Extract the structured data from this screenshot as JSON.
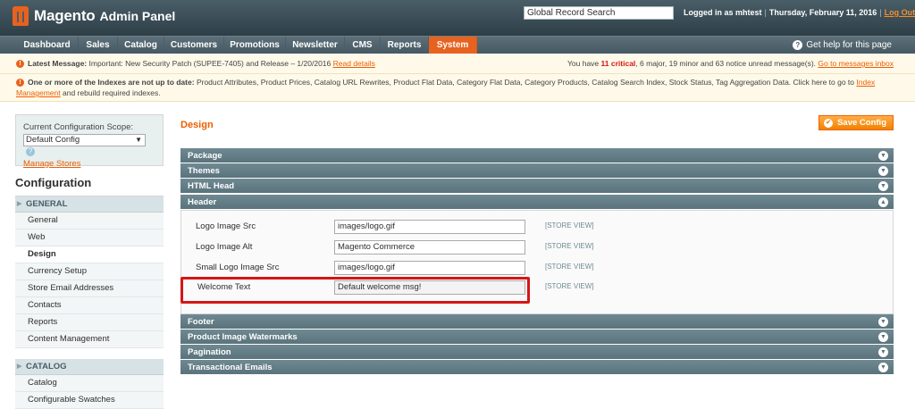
{
  "header": {
    "logo_text": "Magento",
    "logo_sub": "Admin Panel",
    "search_value": "Global Record Search",
    "logged_in": "Logged in as mhtest",
    "date": "Thursday, February 11, 2016",
    "logout": "Log Out"
  },
  "nav": {
    "items": [
      "Dashboard",
      "Sales",
      "Catalog",
      "Customers",
      "Promotions",
      "Newsletter",
      "CMS",
      "Reports",
      "System"
    ],
    "active": "System",
    "help": "Get help for this page"
  },
  "messages": {
    "latest_label": "Latest Message:",
    "latest_text": "Important: New Security Patch (SUPEE-7405) and Release – 1/20/2016",
    "latest_link": "Read details",
    "summary_pre": "You have",
    "critical": "11 critical",
    "summary_mid": ", 6 major, 19 minor and 63 notice unread message(s).",
    "summary_link": "Go to messages inbox",
    "index_label": "One or more of the Indexes are not up to date:",
    "index_text": "Product Attributes, Product Prices, Catalog URL Rewrites, Product Flat Data, Category Flat Data, Category Products, Catalog Search Index, Stock Status, Tag Aggregation Data. Click here to go to",
    "index_link": "Index Management",
    "index_tail": "and rebuild required indexes."
  },
  "sidebar": {
    "scope_label": "Current Configuration Scope:",
    "scope_value": "Default Config",
    "manage_stores": "Manage Stores",
    "title": "Configuration",
    "groups": [
      {
        "label": "GENERAL",
        "items": [
          "General",
          "Web",
          "Design",
          "Currency Setup",
          "Store Email Addresses",
          "Contacts",
          "Reports",
          "Content Management"
        ]
      },
      {
        "label": "CATALOG",
        "items": [
          "Catalog",
          "Configurable Swatches"
        ]
      }
    ],
    "active_item": "Design"
  },
  "main": {
    "title": "Design",
    "save_label": "Save Config",
    "sections_top": [
      "Package",
      "Themes",
      "HTML Head",
      "Header"
    ],
    "sections_bottom": [
      "Footer",
      "Product Image Watermarks",
      "Pagination",
      "Transactional Emails"
    ],
    "header_fields": [
      {
        "label": "Logo Image Src",
        "value": "images/logo.gif",
        "scope": "[STORE VIEW]"
      },
      {
        "label": "Logo Image Alt",
        "value": "Magento Commerce",
        "scope": "[STORE VIEW]"
      },
      {
        "label": "Small Logo Image Src",
        "value": "images/logo.gif",
        "scope": "[STORE VIEW]"
      },
      {
        "label": "Welcome Text",
        "value": "Default welcome msg!",
        "scope": "[STORE VIEW]"
      }
    ]
  },
  "colors": {
    "accent": "#e8621f",
    "header_bg": "#2d3e46",
    "section_bg": "#6f8992",
    "highlight": "#d41616"
  }
}
